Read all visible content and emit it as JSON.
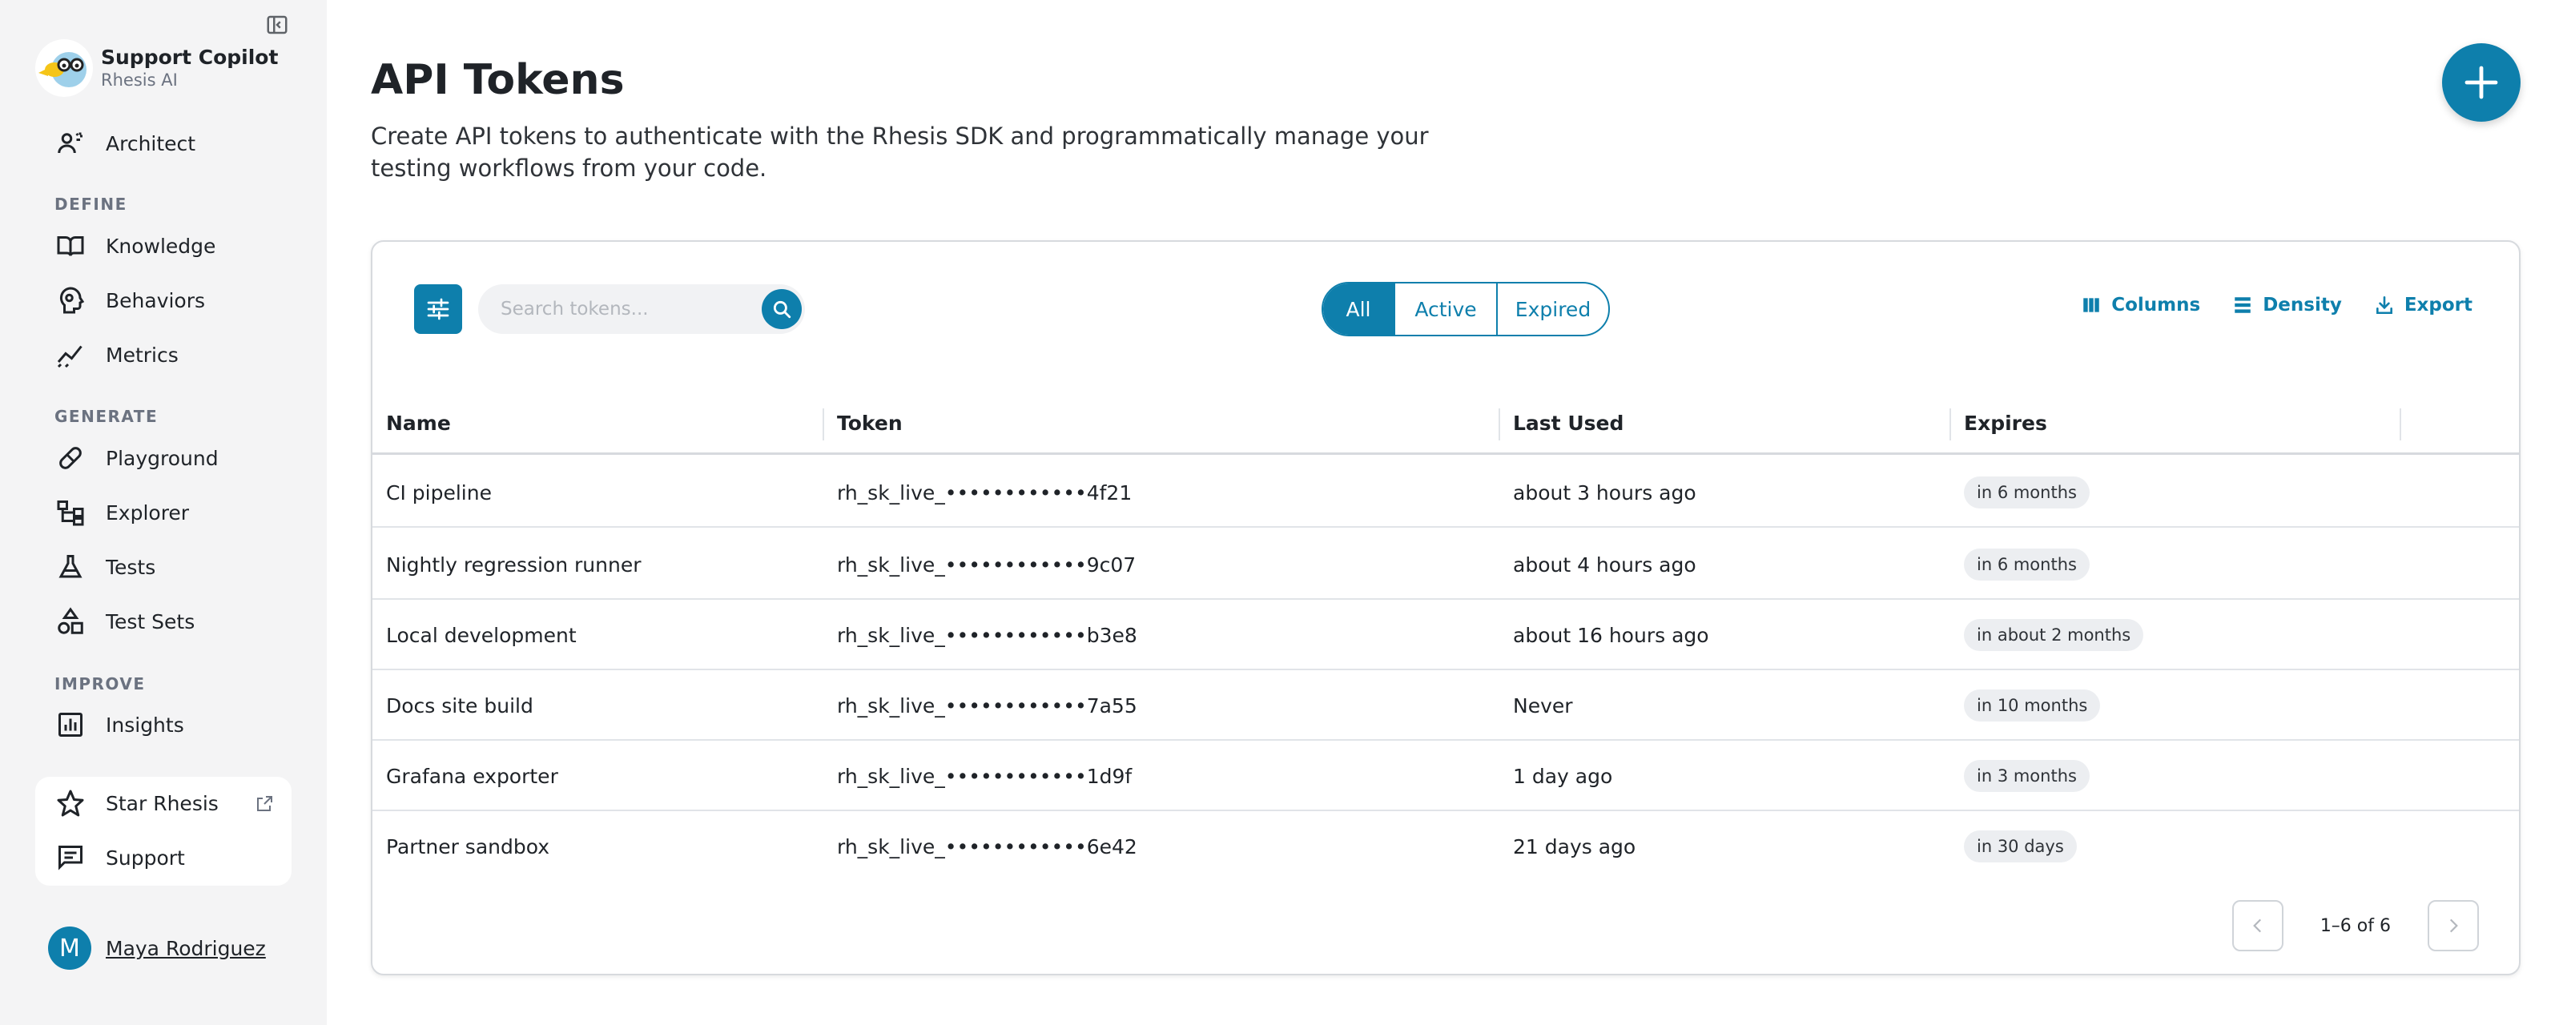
{
  "brand": {
    "name": "Support Copilot",
    "org": "Rhesis AI"
  },
  "sidebar": {
    "top_item": {
      "label": "Architect",
      "icon": "architect-icon"
    },
    "sections": [
      {
        "title": "DEFINE",
        "items": [
          {
            "label": "Knowledge",
            "icon": "book-icon"
          },
          {
            "label": "Behaviors",
            "icon": "head-icon"
          },
          {
            "label": "Metrics",
            "icon": "chart-line-icon"
          }
        ]
      },
      {
        "title": "GENERATE",
        "items": [
          {
            "label": "Playground",
            "icon": "pill-icon"
          },
          {
            "label": "Explorer",
            "icon": "tree-icon"
          },
          {
            "label": "Tests",
            "icon": "flask-icon"
          },
          {
            "label": "Test Sets",
            "icon": "shapes-icon"
          }
        ]
      },
      {
        "title": "IMPROVE",
        "items": [
          {
            "label": "Insights",
            "icon": "bar-chart-icon"
          }
        ]
      }
    ],
    "bottom": [
      {
        "label": "Star Rhesis",
        "icon": "star-icon"
      },
      {
        "label": "Support",
        "icon": "chat-icon"
      }
    ],
    "user": {
      "initial": "M",
      "name": "Maya Rodriguez"
    }
  },
  "page": {
    "title": "API Tokens",
    "description": "Create API tokens to authenticate with the Rhesis SDK and programmatically manage your testing workflows from your code."
  },
  "toolbar": {
    "search_placeholder": "Search tokens...",
    "filters": [
      "All",
      "Active",
      "Expired"
    ],
    "active_filter": "All",
    "columns_label": "Columns",
    "density_label": "Density",
    "export_label": "Export"
  },
  "table": {
    "headers": [
      "Name",
      "Token",
      "Last Used",
      "Expires"
    ],
    "rows": [
      {
        "name": "CI pipeline",
        "token": "rh_sk_live_••••••••••••4f21",
        "last_used": "about 3 hours ago",
        "expires": "in 6 months"
      },
      {
        "name": "Nightly regression runner",
        "token": "rh_sk_live_••••••••••••9c07",
        "last_used": "about 4 hours ago",
        "expires": "in 6 months"
      },
      {
        "name": "Local development",
        "token": "rh_sk_live_••••••••••••b3e8",
        "last_used": "about 16 hours ago",
        "expires": "in about 2 months"
      },
      {
        "name": "Docs site build",
        "token": "rh_sk_live_••••••••••••7a55",
        "last_used": "Never",
        "expires": "in 10 months"
      },
      {
        "name": "Grafana exporter",
        "token": "rh_sk_live_••••••••••••1d9f",
        "last_used": "1 day ago",
        "expires": "in 3 months"
      },
      {
        "name": "Partner sandbox",
        "token": "rh_sk_live_••••••••••••6e42",
        "last_used": "21 days ago",
        "expires": "in 30 days"
      }
    ]
  },
  "pagination": {
    "range": "1–6 of 6"
  },
  "colors": {
    "accent": "#0e7fac",
    "sidebar_bg": "#f4f4f5"
  }
}
